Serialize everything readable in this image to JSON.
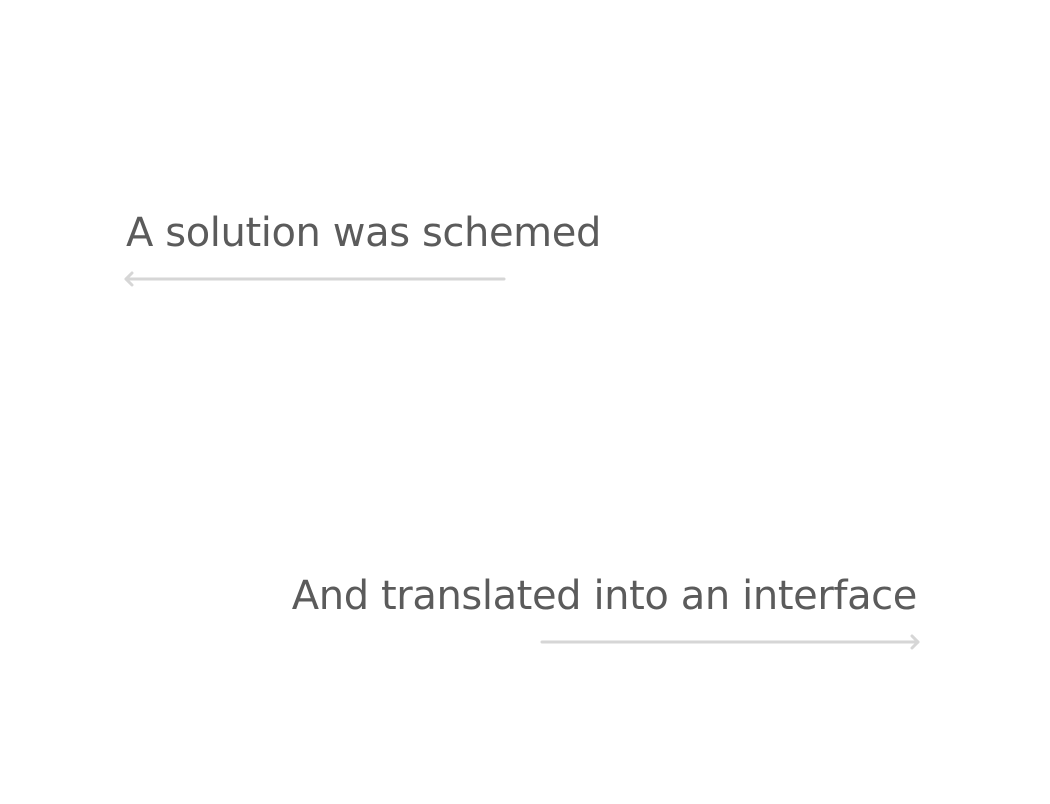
{
  "captions": {
    "first": "A solution was schemed",
    "second": "And translated into an interface"
  },
  "arrows": {
    "first_direction": "left",
    "second_direction": "right",
    "color": "#d6d6d6"
  },
  "text_color": "#5b5b5b",
  "background": "#ffffff"
}
